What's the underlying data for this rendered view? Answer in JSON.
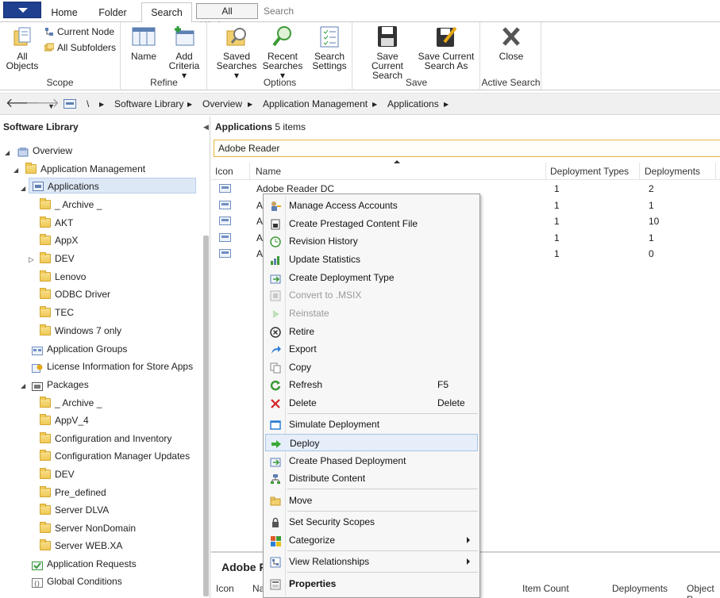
{
  "ribbon_tabs": {
    "home": "Home",
    "folder": "Folder",
    "search": "Search",
    "context_group": "All Workspaces",
    "context_search": "Search"
  },
  "ribbon": {
    "scope": {
      "label": "Scope",
      "all_objects_1": "All",
      "all_objects_2": "Objects",
      "current_node": "Current Node",
      "all_subfolders": "All Subfolders"
    },
    "refine": {
      "label": "Refine",
      "name": "Name",
      "add_criteria_1": "Add",
      "add_criteria_2": "Criteria"
    },
    "options": {
      "label": "Options",
      "saved_1": "Saved",
      "saved_2": "Searches",
      "recent_1": "Recent",
      "recent_2": "Searches",
      "settings_1": "Search",
      "settings_2": "Settings"
    },
    "save": {
      "label": "Save",
      "save_current_1": "Save Current",
      "save_current_2": "Search",
      "save_as_1": "Save Current",
      "save_as_2": "Search As"
    },
    "active_search": {
      "label": "Active Search",
      "close": "Close"
    }
  },
  "breadcrumb": {
    "root": "\\",
    "items": [
      "Software Library",
      "Overview",
      "Application Management",
      "Applications"
    ]
  },
  "left_pane": {
    "title": "Software Library",
    "tree": [
      "Overview",
      "Application Management",
      "Applications",
      "_ Archive _",
      "AKT",
      "AppX",
      "DEV",
      "Lenovo",
      "ODBC Driver",
      "TEC",
      "Windows 7 only",
      "Application Groups",
      "License Information for Store Apps",
      "Packages",
      "_ Archive _",
      "AppV_4",
      "Configuration and Inventory",
      "Configuration Manager Updates",
      "DEV",
      "Pre_defined",
      "Server DLVA",
      "Server NonDomain",
      "Server WEB.XA",
      "Application Requests",
      "Global Conditions"
    ]
  },
  "right_pane": {
    "title_bold": "Applications",
    "title_count": "5 items",
    "search_value": "Adobe Reader",
    "columns": [
      "Icon",
      "Name",
      "Deployment Types",
      "Deployments"
    ],
    "rows": [
      {
        "name": "Adobe Reader DC",
        "types": "1",
        "deployments": "2"
      },
      {
        "name": "A",
        "types": "1",
        "deployments": "1"
      },
      {
        "name": "A",
        "types": "1",
        "deployments": "10"
      },
      {
        "name": "A",
        "types": "1",
        "deployments": "1"
      },
      {
        "name": "A",
        "types": "1",
        "deployments": "0"
      }
    ],
    "details_title": "Adobe R",
    "details_columns": [
      "Icon",
      "Na",
      "Item Count",
      "Deployments",
      "Object P"
    ]
  },
  "context_menu": [
    {
      "label": "Manage Access Accounts",
      "icon": "users-key-icon"
    },
    {
      "label": "Create Prestaged Content File",
      "icon": "prestaged-file-icon"
    },
    {
      "label": "Revision History",
      "icon": "history-icon"
    },
    {
      "label": "Update Statistics",
      "icon": "statistics-icon"
    },
    {
      "label": "Create Deployment Type",
      "icon": "deployment-type-icon"
    },
    {
      "label": "Convert to .MSIX",
      "icon": "msix-icon"
    },
    {
      "label": "Reinstate",
      "icon": "reinstate-icon"
    },
    {
      "label": "Retire",
      "icon": "retire-icon"
    },
    {
      "label": "Export",
      "icon": "export-icon"
    },
    {
      "label": "Copy",
      "icon": "copy-icon"
    },
    {
      "label": "Refresh",
      "icon": "refresh-icon",
      "shortcut": "F5"
    },
    {
      "label": "Delete",
      "icon": "delete-icon",
      "shortcut": "Delete"
    },
    {
      "label": "Simulate Deployment",
      "icon": "simulate-icon"
    },
    {
      "label": "Deploy",
      "icon": "deploy-arrow-icon"
    },
    {
      "label": "Create Phased Deployment",
      "icon": "phased-deployment-icon"
    },
    {
      "label": "Distribute Content",
      "icon": "distribute-icon"
    },
    {
      "label": "Move",
      "icon": "move-folder-icon"
    },
    {
      "label": "Set Security Scopes",
      "icon": "security-scope-icon"
    },
    {
      "label": "Categorize",
      "icon": "categorize-icon"
    },
    {
      "label": "View Relationships",
      "icon": "relationships-icon"
    },
    {
      "label": "Properties",
      "icon": "properties-icon"
    }
  ],
  "colors": {
    "app_button": "#1f3f8f",
    "selection": "#dde8f6",
    "search_border": "#e3b640",
    "menu_highlight": "#e5eef9"
  }
}
